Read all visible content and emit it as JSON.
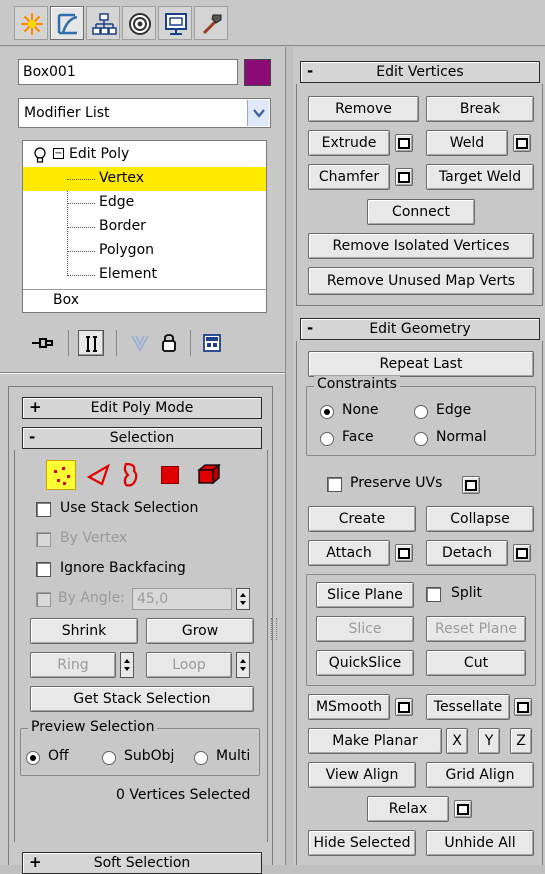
{
  "tabs": [
    {
      "name": "create-tab-icon"
    },
    {
      "name": "modify-tab-icon"
    },
    {
      "name": "hierarchy-tab-icon"
    },
    {
      "name": "motion-tab-icon"
    },
    {
      "name": "display-tab-icon"
    },
    {
      "name": "utilities-tab-icon"
    }
  ],
  "object": {
    "name": "Box001",
    "color": "#8b0c74"
  },
  "modifier_list": {
    "label": "Modifier List"
  },
  "stack": {
    "root": "Edit Poly",
    "items": [
      "Vertex",
      "Edge",
      "Border",
      "Polygon",
      "Element"
    ],
    "selected": "Vertex",
    "base": "Box"
  },
  "edit_poly_mode": {
    "title": "Edit Poly Mode"
  },
  "selection": {
    "title": "Selection",
    "use_stack_selection": "Use Stack Selection",
    "by_vertex": "By Vertex",
    "ignore_backfacing": "Ignore Backfacing",
    "by_angle": "By Angle:",
    "angle_value": "45,0",
    "shrink": "Shrink",
    "grow": "Grow",
    "ring": "Ring",
    "loop": "Loop",
    "get_stack_selection": "Get Stack Selection",
    "preview_title": "Preview Selection",
    "off": "Off",
    "subobj": "SubObj",
    "multi": "Multi",
    "status": "0 Vertices Selected"
  },
  "soft_selection": {
    "title": "Soft Selection"
  },
  "edit_vertices": {
    "title": "Edit Vertices",
    "remove": "Remove",
    "break": "Break",
    "extrude": "Extrude",
    "weld": "Weld",
    "chamfer": "Chamfer",
    "target_weld": "Target Weld",
    "connect": "Connect",
    "remove_isolated": "Remove Isolated Vertices",
    "remove_unused": "Remove Unused Map Verts"
  },
  "edit_geometry": {
    "title": "Edit Geometry",
    "repeat_last": "Repeat Last",
    "constraints": "Constraints",
    "none": "None",
    "edge": "Edge",
    "face": "Face",
    "normal": "Normal",
    "preserve_uvs": "Preserve UVs",
    "create": "Create",
    "collapse": "Collapse",
    "attach": "Attach",
    "detach": "Detach",
    "slice_plane": "Slice Plane",
    "split": "Split",
    "slice": "Slice",
    "reset_plane": "Reset Plane",
    "quickslice": "QuickSlice",
    "cut": "Cut",
    "msmooth": "MSmooth",
    "tessellate": "Tessellate",
    "make_planar": "Make Planar",
    "x": "X",
    "y": "Y",
    "z": "Z",
    "view_align": "View Align",
    "grid_align": "Grid Align",
    "relax": "Relax",
    "hide_selected": "Hide Selected",
    "unhide_all": "Unhide All"
  }
}
